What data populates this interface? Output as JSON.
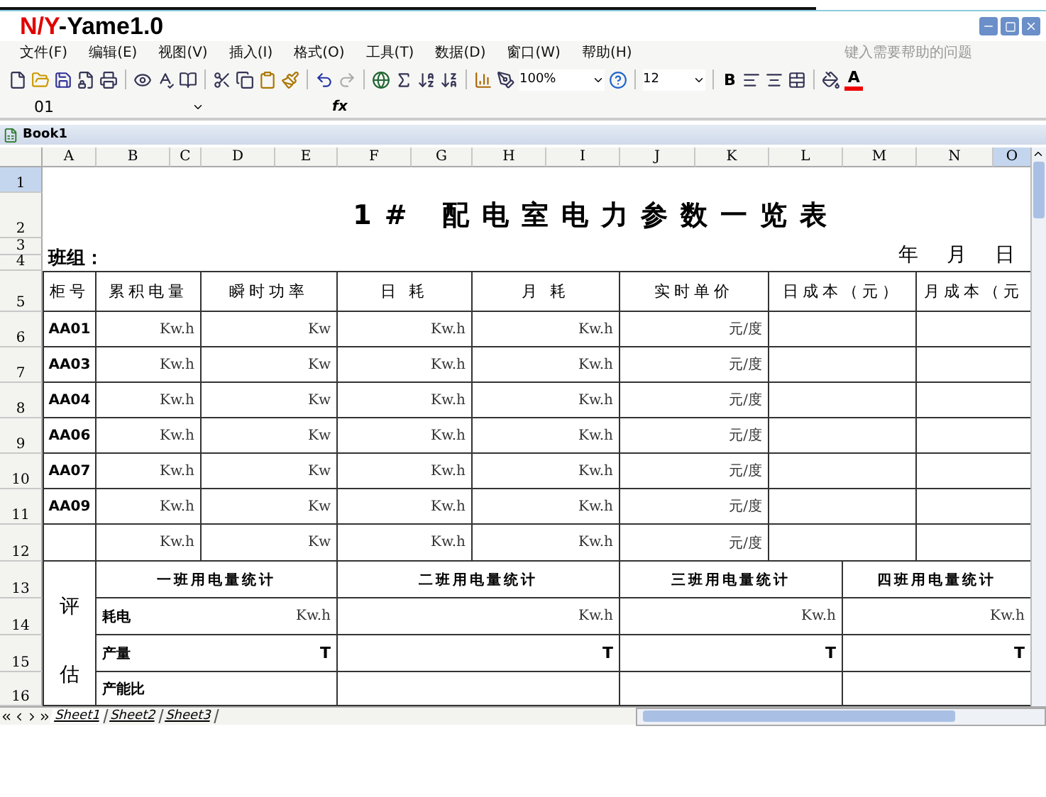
{
  "title_parts": [
    {
      "text": "N/Y",
      "color": "#e00000"
    },
    {
      "text": "-Yame1.0",
      "color": "#000000"
    }
  ],
  "menu": [
    "文件(F)",
    "编辑(E)",
    "视图(V)",
    "插入(I)",
    "格式(O)",
    "工具(T)",
    "数据(D)",
    "窗口(W)",
    "帮助(H)"
  ],
  "help_field": {
    "placeholder": "键入需要帮助的问题"
  },
  "toolbar": {
    "zoom": "100%",
    "font_size": "12",
    "bold": "B",
    "font_color": "A"
  },
  "formula_bar": {
    "name_box": "01",
    "function_label": "fx"
  },
  "workbook": {
    "title": "Book1"
  },
  "columns": [
    {
      "label": "A",
      "selected": false
    },
    {
      "label": "B",
      "selected": false
    },
    {
      "label": "C",
      "selected": false
    },
    {
      "label": "D",
      "selected": false
    },
    {
      "label": "E",
      "selected": false
    },
    {
      "label": "F",
      "selected": false
    },
    {
      "label": "G",
      "selected": false
    },
    {
      "label": "H",
      "selected": false
    },
    {
      "label": "I",
      "selected": false
    },
    {
      "label": "J",
      "selected": false
    },
    {
      "label": "K",
      "selected": false
    },
    {
      "label": "L",
      "selected": false
    },
    {
      "label": "M",
      "selected": false
    },
    {
      "label": "N",
      "selected": false
    },
    {
      "label": "O",
      "selected": true
    }
  ],
  "row_numbers": [
    {
      "label": "1",
      "selected": true
    },
    {
      "label": "2",
      "selected": false
    },
    {
      "label": "3",
      "selected": false
    },
    {
      "label": "4",
      "selected": false
    },
    {
      "label": "5",
      "selected": false
    },
    {
      "label": "6",
      "selected": false
    },
    {
      "label": "7",
      "selected": false
    },
    {
      "label": "8",
      "selected": false
    },
    {
      "label": "9",
      "selected": false
    },
    {
      "label": "10",
      "selected": false
    },
    {
      "label": "11",
      "selected": false
    },
    {
      "label": "12",
      "selected": false
    },
    {
      "label": "13",
      "selected": false
    },
    {
      "label": "14",
      "selected": false
    },
    {
      "label": "15",
      "selected": false
    },
    {
      "label": "16",
      "selected": false
    }
  ],
  "sheet": {
    "title": "1# 配电室电力参数一览表",
    "team_label": "班组：",
    "date_parts": [
      "年",
      "月",
      "日"
    ],
    "headers": [
      "柜号",
      "累积电量",
      "瞬时功率",
      "日 耗",
      "月 耗",
      "实时单价",
      "日成本（元）",
      "月成本（元"
    ],
    "rows": [
      {
        "cabinet": "AA01",
        "total_energy": "Kw.h",
        "power": "Kw",
        "daily": "Kw.h",
        "monthly": "Kw.h",
        "price": "元/度"
      },
      {
        "cabinet": "AA03",
        "total_energy": "Kw.h",
        "power": "Kw",
        "daily": "Kw.h",
        "monthly": "Kw.h",
        "price": "元/度"
      },
      {
        "cabinet": "AA04",
        "total_energy": "Kw.h",
        "power": "Kw",
        "daily": "Kw.h",
        "monthly": "Kw.h",
        "price": "元/度"
      },
      {
        "cabinet": "AA06",
        "total_energy": "Kw.h",
        "power": "Kw",
        "daily": "Kw.h",
        "monthly": "Kw.h",
        "price": "元/度"
      },
      {
        "cabinet": "AA07",
        "total_energy": "Kw.h",
        "power": "Kw",
        "daily": "Kw.h",
        "monthly": "Kw.h",
        "price": "元/度"
      },
      {
        "cabinet": "AA09",
        "total_energy": "Kw.h",
        "power": "Kw",
        "daily": "Kw.h",
        "monthly": "Kw.h",
        "price": "元/度"
      },
      {
        "total_energy": "Kw.h",
        "power": "Kw",
        "daily": "Kw.h",
        "monthly": "Kw.h",
        "price": "元/度"
      }
    ],
    "evaluation": {
      "side_label": [
        "评",
        "估"
      ],
      "shifts": [
        "一班用电量统计",
        "二班用电量统计",
        "三班用电量统计",
        "四班用电量统计"
      ],
      "rows": [
        {
          "label": "耗电",
          "units": [
            "Kw.h",
            "Kw.h",
            "Kw.h",
            "Kw.h"
          ]
        },
        {
          "label": "产量",
          "units": [
            "T",
            "T",
            "T",
            "T"
          ]
        },
        {
          "label": "产能比"
        }
      ]
    }
  },
  "sheet_tabs": [
    {
      "label": "Sheet1",
      "selected": true
    },
    {
      "label": "Sheet2",
      "selected": false
    },
    {
      "label": "Sheet3",
      "selected": false
    }
  ]
}
